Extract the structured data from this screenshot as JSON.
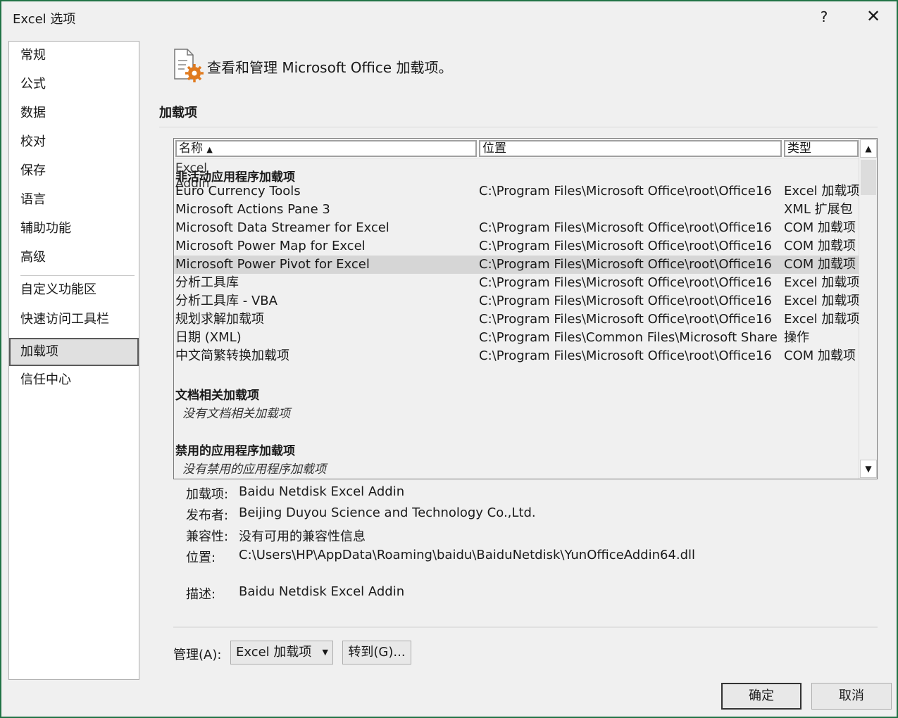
{
  "window": {
    "title": "Excel 选项",
    "help_glyph": "?",
    "close_glyph": "✕",
    "accent_color": "#217346"
  },
  "sidebar": {
    "items": [
      {
        "label": "常规"
      },
      {
        "label": "公式"
      },
      {
        "label": "数据"
      },
      {
        "label": "校对"
      },
      {
        "label": "保存"
      },
      {
        "label": "语言"
      },
      {
        "label": "辅助功能"
      },
      {
        "label": "高级"
      },
      {
        "label": "自定义功能区"
      },
      {
        "label": "快速访问工具栏"
      },
      {
        "label": "加载项"
      },
      {
        "label": "信任中心"
      }
    ],
    "active": "加载项"
  },
  "main": {
    "header_text": "查看和管理 Microsoft Office 加载项。",
    "section_label": "加载项"
  },
  "listbox": {
    "columns": [
      {
        "label": "名称",
        "sort": "ascending"
      },
      {
        "label": "位置"
      },
      {
        "label": "类型"
      }
    ],
    "overlap_lines": [
      "Excel",
      "Addin"
    ],
    "groups": [
      {
        "title": "非活动应用程序加载项",
        "rows": [
          {
            "name": "Euro Currency Tools",
            "location": "C:\\Program Files\\Microsoft Office\\root\\Office16",
            "type": "Excel 加载项",
            "selected": false
          },
          {
            "name": "Microsoft Actions Pane 3",
            "location": "",
            "type": "XML 扩展包",
            "selected": false
          },
          {
            "name": "Microsoft Data Streamer for Excel",
            "location": "C:\\Program Files\\Microsoft Office\\root\\Office16",
            "type": "COM 加载项",
            "selected": false
          },
          {
            "name": "Microsoft Power Map for Excel",
            "location": "C:\\Program Files\\Microsoft Office\\root\\Office16",
            "type": "COM 加载项",
            "selected": false
          },
          {
            "name": "Microsoft Power Pivot for Excel",
            "location": "C:\\Program Files\\Microsoft Office\\root\\Office16",
            "type": "COM 加载项",
            "selected": true
          },
          {
            "name": "分析工具库",
            "location": "C:\\Program Files\\Microsoft Office\\root\\Office16",
            "type": "Excel 加载项",
            "selected": false
          },
          {
            "name": "分析工具库 - VBA",
            "location": "C:\\Program Files\\Microsoft Office\\root\\Office16",
            "type": "Excel 加载项",
            "selected": false
          },
          {
            "name": "规划求解加载项",
            "location": "C:\\Program Files\\Microsoft Office\\root\\Office16",
            "type": "Excel 加载项",
            "selected": false
          },
          {
            "name": "日期 (XML)",
            "location": "C:\\Program Files\\Common Files\\Microsoft Share",
            "type": "操作",
            "selected": false
          },
          {
            "name": "中文简繁转换加载项",
            "location": "C:\\Program Files\\Microsoft Office\\root\\Office16",
            "type": "COM 加载项",
            "selected": false
          }
        ]
      },
      {
        "title": "文档相关加载项",
        "empty_note": "没有文档相关加载项"
      },
      {
        "title": "禁用的应用程序加载项",
        "empty_note": "没有禁用的应用程序加载项"
      }
    ]
  },
  "details": {
    "addin_label": "加载项:",
    "addin_value": "Baidu Netdisk Excel Addin",
    "publisher_label": "发布者:",
    "publisher_value": "Beijing Duyou Science and Technology Co.,Ltd.",
    "compat_label": "兼容性:",
    "compat_value": "没有可用的兼容性信息",
    "location_label": "位置:",
    "location_value": "C:\\Users\\HP\\AppData\\Roaming\\baidu\\BaiduNetdisk\\YunOfficeAddin64.dll",
    "desc_label": "描述:",
    "desc_value": "Baidu Netdisk Excel Addin"
  },
  "manage": {
    "label": "管理(A):",
    "selected": "Excel 加载项",
    "goto_label": "转到(G)..."
  },
  "footer": {
    "ok_label": "确定",
    "cancel_label": "取消"
  }
}
